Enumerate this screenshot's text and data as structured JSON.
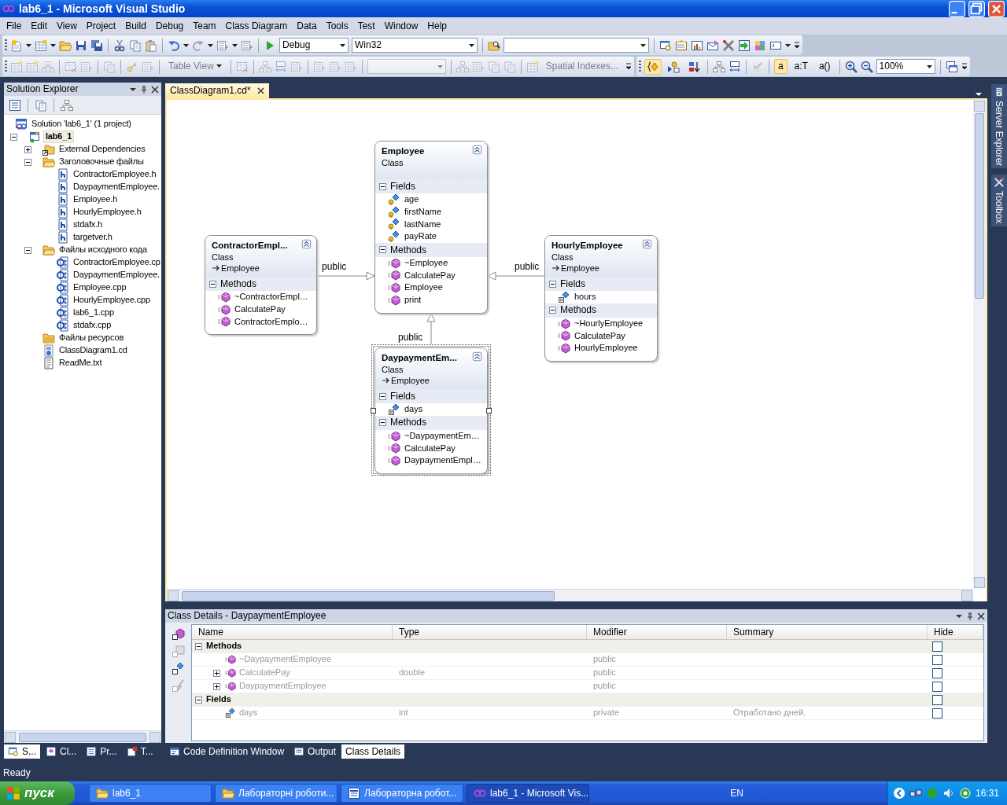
{
  "window": {
    "title": "lab6_1 - Microsoft Visual Studio"
  },
  "menu": [
    "File",
    "Edit",
    "View",
    "Project",
    "Build",
    "Debug",
    "Team",
    "Class Diagram",
    "Data",
    "Tools",
    "Test",
    "Window",
    "Help"
  ],
  "toolbar_standard": {
    "items": [
      {
        "kind": "combo",
        "value": "Debug"
      },
      {
        "kind": "combo",
        "value": "Win32"
      },
      {
        "kind": "combo"
      }
    ]
  },
  "toolbar_table": {
    "disabled": true,
    "items": [
      {
        "kind": "dropdown",
        "label": "Table View"
      },
      {
        "kind": "combo"
      },
      {
        "kind": "button",
        "label": "Spatial Indexes..."
      }
    ]
  },
  "toolbar_class": {
    "items": [
      {
        "kind": "icon",
        "on": true
      },
      {
        "kind": "icon",
        "on": false
      },
      {
        "kind": "icon",
        "on": false
      },
      {
        "kind": "text",
        "label": "a",
        "on": true
      },
      {
        "kind": "text",
        "label": "a:T",
        "on": false
      },
      {
        "kind": "text",
        "label": "a()",
        "on": false
      },
      {
        "kind": "combo",
        "value": "100%"
      }
    ]
  },
  "solution_explorer": {
    "title": "Solution Explorer",
    "tree": [
      {
        "kind": "solution",
        "label": "Solution 'lab6_1' (1 project)",
        "selected": false,
        "children": [
          {
            "kind": "project",
            "label": "lab6_1",
            "selected": true,
            "expanded": true,
            "children": [
              {
                "kind": "dependencies",
                "label": "External Dependencies",
                "selected": false,
                "expanded": false
              },
              {
                "kind": "folder",
                "label": "Заголовочные файлы",
                "selected": false,
                "expanded": true,
                "children": [
                  {
                    "kind": "header",
                    "label": "ContractorEmployee.h",
                    "selected": false
                  },
                  {
                    "kind": "header",
                    "label": "DaypaymentEmployee.",
                    "selected": false
                  },
                  {
                    "kind": "header",
                    "label": "Employee.h",
                    "selected": false
                  },
                  {
                    "kind": "header",
                    "label": "HourlyEmployee.h",
                    "selected": false
                  },
                  {
                    "kind": "header",
                    "label": "stdafx.h",
                    "selected": false
                  },
                  {
                    "kind": "header",
                    "label": "targetver.h",
                    "selected": false
                  }
                ]
              },
              {
                "kind": "folder",
                "label": "Файлы исходного кода",
                "selected": false,
                "expanded": true,
                "children": [
                  {
                    "kind": "source",
                    "label": "ContractorEmployee.cp",
                    "selected": false
                  },
                  {
                    "kind": "source",
                    "label": "DaypaymentEmployee.",
                    "selected": false
                  },
                  {
                    "kind": "source",
                    "label": "Employee.cpp",
                    "selected": false
                  },
                  {
                    "kind": "source",
                    "label": "HourlyEmployee.cpp",
                    "selected": false
                  },
                  {
                    "kind": "source",
                    "label": "lab6_1.cpp",
                    "selected": false
                  },
                  {
                    "kind": "source",
                    "label": "stdafx.cpp",
                    "selected": false
                  }
                ]
              },
              {
                "kind": "folder",
                "label": "Файлы ресурсов",
                "selected": false
              },
              {
                "kind": "diagram",
                "label": "ClassDiagram1.cd",
                "selected": false
              },
              {
                "kind": "text",
                "label": "ReadMe.txt",
                "selected": false
              }
            ]
          }
        ]
      }
    ],
    "tabs": [
      {
        "label": "S...",
        "selected": true
      },
      {
        "label": "Cl...",
        "selected": false
      },
      {
        "label": "Pr...",
        "selected": false
      },
      {
        "label": "T...",
        "selected": false
      }
    ]
  },
  "document_tabs": [
    {
      "label": "ClassDiagram1.cd*",
      "selected": true
    }
  ],
  "diagram": {
    "classes": [
      {
        "name": "Employee",
        "subtitle": "Class",
        "selected": false,
        "sections": [
          {
            "title": "Fields",
            "expanded": true,
            "members": [
              {
                "kind": "protected_field",
                "name": "age"
              },
              {
                "kind": "protected_field",
                "name": "firstName"
              },
              {
                "kind": "protected_field",
                "name": "lastName"
              },
              {
                "kind": "protected_field",
                "name": "payRate"
              }
            ]
          },
          {
            "title": "Methods",
            "expanded": true,
            "members": [
              {
                "kind": "method",
                "name": "~Employee"
              },
              {
                "kind": "method",
                "name": "CalculatePay"
              },
              {
                "kind": "method",
                "name": "Employee"
              },
              {
                "kind": "method",
                "name": "print"
              }
            ]
          }
        ]
      },
      {
        "name": "ContractorEmpl...",
        "subtitle": "Class",
        "base": "Employee",
        "selected": false,
        "sections": [
          {
            "title": "Methods",
            "expanded": true,
            "members": [
              {
                "kind": "method",
                "name": "~ContractorEmpl…"
              },
              {
                "kind": "method",
                "name": "CalculatePay"
              },
              {
                "kind": "method",
                "name": "ContractorEmplo…"
              }
            ]
          }
        ]
      },
      {
        "name": "HourlyEmployee",
        "subtitle": "Class",
        "base": "Employee",
        "selected": false,
        "sections": [
          {
            "title": "Fields",
            "expanded": true,
            "members": [
              {
                "kind": "private_field",
                "name": "hours"
              }
            ]
          },
          {
            "title": "Methods",
            "expanded": true,
            "members": [
              {
                "kind": "method",
                "name": "~HourlyEmployee"
              },
              {
                "kind": "method",
                "name": "CalculatePay"
              },
              {
                "kind": "method",
                "name": "HourlyEmployee"
              }
            ]
          }
        ]
      },
      {
        "name": "DaypaymentEm...",
        "subtitle": "Class",
        "base": "Employee",
        "selected": true,
        "sections": [
          {
            "title": "Fields",
            "expanded": true,
            "members": [
              {
                "kind": "private_field",
                "name": "days"
              }
            ]
          },
          {
            "title": "Methods",
            "expanded": true,
            "members": [
              {
                "kind": "method",
                "name": "~DaypaymentEm…"
              },
              {
                "kind": "method",
                "name": "CalculatePay"
              },
              {
                "kind": "method",
                "name": "DaypaymentEmpl…"
              }
            ]
          }
        ]
      }
    ],
    "relations": [
      {
        "label": "public"
      },
      {
        "label": "public"
      },
      {
        "label": "public"
      }
    ]
  },
  "class_details": {
    "title": "Class Details - DaypaymentEmployee",
    "columns": [
      "Name",
      "Type",
      "Modifier",
      "Summary",
      "Hide"
    ],
    "rows": [
      {
        "kind": "group",
        "name": "Methods",
        "expanded": true,
        "hide": false
      },
      {
        "kind": "method",
        "name": "~DaypaymentEmployee",
        "modifier": "public",
        "hide": false
      },
      {
        "kind": "method",
        "name": "CalculatePay",
        "type": "double",
        "modifier": "public",
        "expanded": false,
        "hide": false
      },
      {
        "kind": "method",
        "name": "DaypaymentEmployee",
        "modifier": "public",
        "expanded": false,
        "hide": false
      },
      {
        "kind": "group",
        "name": "Fields",
        "expanded": true,
        "hide": false
      },
      {
        "kind": "field",
        "name": "days",
        "type": "int",
        "modifier": "private",
        "summary": "Отработано дней.",
        "hide": false
      }
    ]
  },
  "bottom_tabs": [
    {
      "label": "Code Definition Window",
      "selected": false
    },
    {
      "label": "Output",
      "selected": false
    },
    {
      "label": "Class Details",
      "selected": true
    }
  ],
  "side_tabs": [
    "Server Explorer",
    "Toolbox"
  ],
  "status_bar": {
    "text": "Ready"
  },
  "taskbar": {
    "start": "пуск",
    "tasks": [
      {
        "kind": "folder",
        "label": "lab6_1",
        "selected": false
      },
      {
        "kind": "folder",
        "label": "Лабораторні роботи...",
        "selected": false
      },
      {
        "kind": "word",
        "label": "Лабораторна робот...",
        "selected": false
      },
      {
        "kind": "vs",
        "label": "lab6_1 - Microsoft Vis...",
        "selected": true
      }
    ],
    "language": "EN",
    "clock": "16:31"
  }
}
